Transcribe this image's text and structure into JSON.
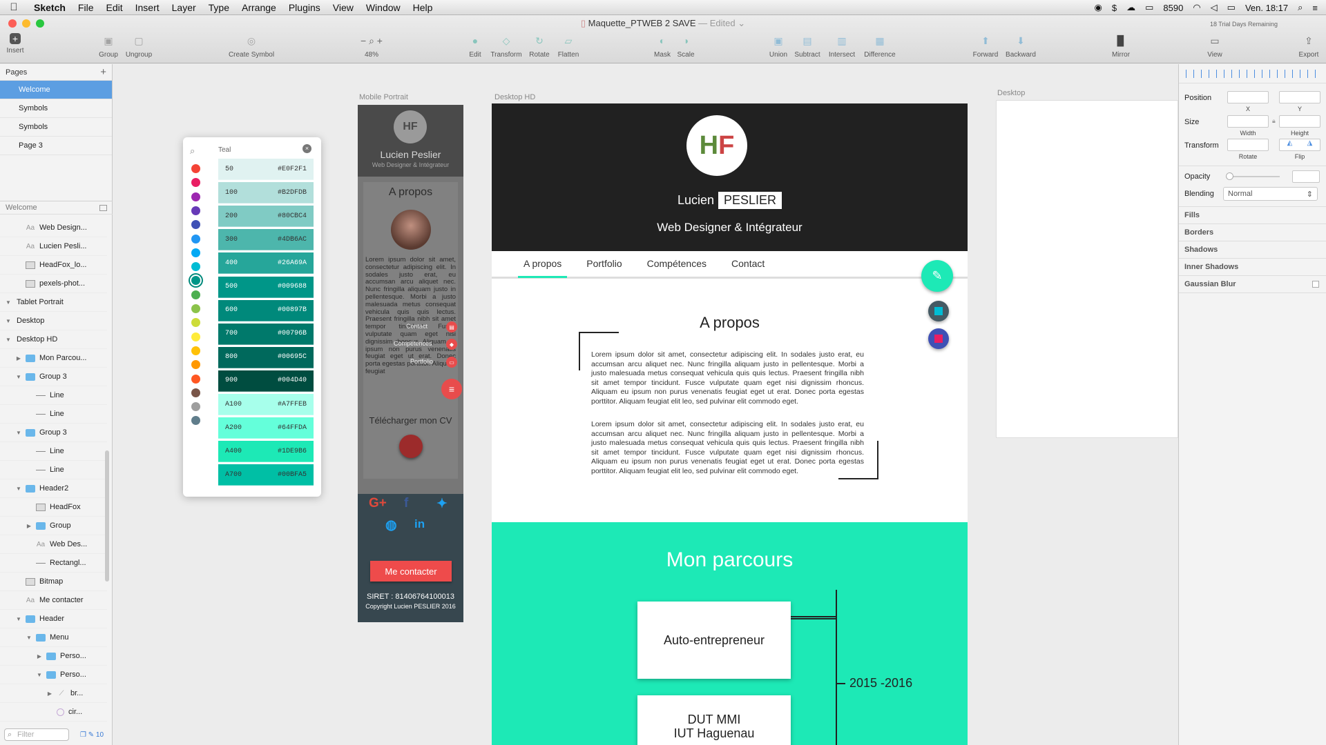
{
  "menubar": {
    "items": [
      "Sketch",
      "File",
      "Edit",
      "Insert",
      "Layer",
      "Type",
      "Arrange",
      "Plugins",
      "View",
      "Window",
      "Help"
    ],
    "status": "8590",
    "clock": "Ven. 18:17"
  },
  "window": {
    "title": "Maquette_PTWEB 2 SAVE",
    "edited": "— Edited ⌄",
    "trial": "18 Trial Days Remaining"
  },
  "toolbar": {
    "insert": "Insert",
    "group": "Group",
    "ungroup": "Ungroup",
    "create_symbol": "Create Symbol",
    "zoom": "48%",
    "edit": "Edit",
    "transform": "Transform",
    "rotate": "Rotate",
    "flatten": "Flatten",
    "mask": "Mask",
    "scale": "Scale",
    "union": "Union",
    "subtract": "Subtract",
    "intersect": "Intersect",
    "difference": "Difference",
    "forward": "Forward",
    "backward": "Backward",
    "mirror": "Mirror",
    "view": "View",
    "export": "Export"
  },
  "pages": {
    "header": "Pages",
    "items": [
      "Welcome",
      "Symbols",
      "Symbols",
      "Page 3"
    ],
    "selected": 0
  },
  "layers": {
    "header": "Welcome",
    "filter_placeholder": "Filter",
    "filter_count": "10",
    "items": [
      {
        "label": "Web Design...",
        "icon": "text",
        "indent": 1,
        "tri": ""
      },
      {
        "label": "Lucien Pesli...",
        "icon": "text",
        "indent": 1,
        "tri": ""
      },
      {
        "label": "HeadFox_lo...",
        "icon": "image",
        "indent": 1,
        "tri": ""
      },
      {
        "label": "pexels-phot...",
        "icon": "image",
        "indent": 1,
        "tri": ""
      },
      {
        "label": "Tablet Portrait",
        "icon": "none",
        "indent": 0,
        "tri": "▼"
      },
      {
        "label": "Desktop",
        "icon": "none",
        "indent": 0,
        "tri": "▼"
      },
      {
        "label": "Desktop HD",
        "icon": "none",
        "indent": 0,
        "tri": "▼"
      },
      {
        "label": "Mon Parcou...",
        "icon": "folder",
        "indent": 1,
        "tri": "▶"
      },
      {
        "label": "Group 3",
        "icon": "folder",
        "indent": 1,
        "tri": "▼"
      },
      {
        "label": "Line",
        "icon": "line",
        "indent": 2,
        "tri": ""
      },
      {
        "label": "Line",
        "icon": "line",
        "indent": 2,
        "tri": ""
      },
      {
        "label": "Group 3",
        "icon": "folder",
        "indent": 1,
        "tri": "▼"
      },
      {
        "label": "Line",
        "icon": "line",
        "indent": 2,
        "tri": ""
      },
      {
        "label": "Line",
        "icon": "line",
        "indent": 2,
        "tri": ""
      },
      {
        "label": "Header2",
        "icon": "folder",
        "indent": 1,
        "tri": "▼"
      },
      {
        "label": "HeadFox",
        "icon": "image",
        "indent": 2,
        "tri": ""
      },
      {
        "label": "Group",
        "icon": "folder",
        "indent": 2,
        "tri": "▶"
      },
      {
        "label": "Web Des...",
        "icon": "text",
        "indent": 2,
        "tri": ""
      },
      {
        "label": "Rectangl...",
        "icon": "line",
        "indent": 2,
        "tri": ""
      },
      {
        "label": "Bitmap",
        "icon": "image",
        "indent": 1,
        "tri": ""
      },
      {
        "label": "Me contacter",
        "icon": "text",
        "indent": 1,
        "tri": ""
      },
      {
        "label": "Header",
        "icon": "folder",
        "indent": 1,
        "tri": "▼"
      },
      {
        "label": "Menu",
        "icon": "folder",
        "indent": 2,
        "tri": "▼"
      },
      {
        "label": "Perso...",
        "icon": "folder",
        "indent": 3,
        "tri": "▶"
      },
      {
        "label": "Perso...",
        "icon": "folder",
        "indent": 3,
        "tri": "▼"
      },
      {
        "label": "br...",
        "icon": "brush",
        "indent": 4,
        "tri": "▶"
      },
      {
        "label": "cir...",
        "icon": "circle",
        "indent": 4,
        "tri": ""
      }
    ]
  },
  "artboards": {
    "mobile": "Mobile Portrait",
    "desktop_hd": "Desktop HD",
    "desktop": "Desktop"
  },
  "color_picker": {
    "label": "Teal",
    "dot_colors": [
      "#f44336",
      "#e91e63",
      "#9c27b0",
      "#673ab7",
      "#3f51b5",
      "#2196f3",
      "#03a9f4",
      "#00bcd4",
      "#009688",
      "#4caf50",
      "#8bc34a",
      "#cddc39",
      "#ffeb3b",
      "#ffc107",
      "#ff9800",
      "#ff5722",
      "#795548",
      "#9e9e9e",
      "#607d8b"
    ],
    "selected_dot": 8,
    "swatches": [
      {
        "name": "50",
        "hex": "#E0F2F1",
        "dark": true
      },
      {
        "name": "100",
        "hex": "#B2DFDB",
        "dark": true
      },
      {
        "name": "200",
        "hex": "#80CBC4",
        "dark": true
      },
      {
        "name": "300",
        "hex": "#4DB6AC",
        "dark": true
      },
      {
        "name": "400",
        "hex": "#26A69A",
        "dark": false
      },
      {
        "name": "500",
        "hex": "#009688",
        "dark": false
      },
      {
        "name": "600",
        "hex": "#00897B",
        "dark": false
      },
      {
        "name": "700",
        "hex": "#00796B",
        "dark": false
      },
      {
        "name": "800",
        "hex": "#00695C",
        "dark": false
      },
      {
        "name": "900",
        "hex": "#004D40",
        "dark": false
      },
      {
        "name": "A100",
        "hex": "#A7FFEB",
        "dark": true
      },
      {
        "name": "A200",
        "hex": "#64FFDA",
        "dark": true
      },
      {
        "name": "A400",
        "hex": "#1DE9B6",
        "dark": true
      },
      {
        "name": "A700",
        "hex": "#00BFA5",
        "dark": true
      }
    ]
  },
  "mobile": {
    "logo": "HF",
    "name": "Lucien Peslier",
    "subtitle": "Web Designer & Intégrateur",
    "about_title": "A propos",
    "lorem": "Lorem ipsum dolor sit amet, consectetur adipiscing elit. In sodales justo erat, eu accumsan arcu aliquet nec. Nunc fringilla aliquam justo in pellentesque. Morbi a justo malesuada metus consequat vehicula quis quis lectus. Praesent fringilla nibh sit amet tempor tincidunt. Fusce vulputate quam eget nisi dignissim rhoncus. Aliquam eu ipsum non purus venenatis feugiat eget ut erat. Donec porta egestas porttitor. Aliquam feugiat",
    "fab_labels": [
      "Contact",
      "Compétences",
      "Portfolio"
    ],
    "cv": "Télécharger mon CV",
    "contact_button": "Me contacter",
    "siret": "SIRET : 81406764100013",
    "copyright": "Copyright Lucien PESLIER 2016"
  },
  "desktop": {
    "logo_h": "H",
    "logo_f": "F",
    "first_name": "Lucien",
    "last_name": "PESLIER",
    "role": "Web Designer & Intégrateur",
    "nav": [
      "A propos",
      "Portfolio",
      "Compétences",
      "Contact"
    ],
    "about_title": "A propos",
    "paragraph1": "Lorem ipsum dolor sit amet, consectetur adipiscing elit. In sodales justo erat, eu accumsan arcu aliquet nec. Nunc fringilla aliquam justo in pellentesque. Morbi a justo malesuada metus consequat vehicula quis quis lectus. Praesent fringilla nibh sit amet tempor tincidunt. Fusce vulputate quam eget nisi dignissim rhoncus. Aliquam eu ipsum non purus venenatis feugiat eget ut erat. Donec porta egestas porttitor. Aliquam feugiat elit leo, sed pulvinar elit commodo eget.",
    "paragraph2": "Lorem ipsum dolor sit amet, consectetur adipiscing elit. In sodales justo erat, eu accumsan arcu aliquet nec. Nunc fringilla aliquam justo in pellentesque. Morbi a justo malesuada metus consequat vehicula quis quis lectus. Praesent fringilla nibh sit amet tempor tincidunt. Fusce vulputate quam eget nisi dignissim rhoncus. Aliquam eu ipsum non purus venenatis feugiat eget ut erat. Donec porta egestas porttitor. Aliquam feugiat elit leo, sed pulvinar elit commodo eget.",
    "parcours_title": "Mon parcours",
    "box1": "Auto-entrepreneur",
    "box2": "DUT MMI",
    "box2_sub": "IUT Haguenau",
    "year": "2015 -2016",
    "accent": "#1de9b6"
  },
  "inspector": {
    "position": "Position",
    "x": "X",
    "y": "Y",
    "size": "Size",
    "width": "Width",
    "height": "Height",
    "transform": "Transform",
    "rotate": "Rotate",
    "flip": "Flip",
    "opacity": "Opacity",
    "blending": "Blending",
    "blending_value": "Normal",
    "sections": [
      "Fills",
      "Borders",
      "Shadows",
      "Inner Shadows",
      "Gaussian Blur"
    ]
  }
}
